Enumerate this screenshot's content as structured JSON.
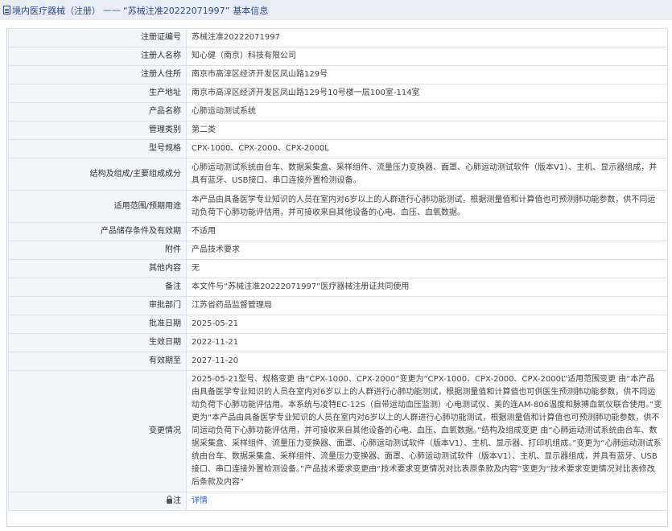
{
  "header": {
    "prefix": "境内医疗器械（注册）",
    "separator": "——",
    "reg_quoted": "“苏械注准20222071997”",
    "suffix": "基本信息"
  },
  "rows": [
    {
      "label": "注册证编号",
      "value": "苏械注准20222071997"
    },
    {
      "label": "注册人名称",
      "value": "知心健（南京）科技有限公司"
    },
    {
      "label": "注册人住所",
      "value": "南京市高淳区经济开发区凤山路129号"
    },
    {
      "label": "生产地址",
      "value": "南京市高淳区经济开发区凤山路129号10号楼一层100室-114室"
    },
    {
      "label": "产品名称",
      "value": "心肺运动测试系统"
    },
    {
      "label": "管理类别",
      "value": "第二类"
    },
    {
      "label": "型号规格",
      "value": "CPX-1000、CPX-2000、CPX-2000L"
    },
    {
      "label": "结构及组成/主要组成成分",
      "value": "心肺运动测试系统由台车、数据采集盒、采样组件、流量压力变换器、面罩、心肺运动测试软件（版本V1）、主机、显示器组成，并具有蓝牙、USB接口、串口连接外置检测设备。"
    },
    {
      "label": "适用范围/预期用途",
      "value": "本产品由具备医学专业知识的人员在室内对6岁以上的人群进行心肺功能测试，根据测量值和计算值也可预测肺功能参数，供不同运动负荷下心肺功能评估用，并可接收来自其他设备的心电、血压、血氧数据。"
    },
    {
      "label": "产品储存条件及有效期",
      "value": "不适用"
    },
    {
      "label": "附件",
      "value": "产品技术要求"
    },
    {
      "label": "其他内容",
      "value": "无"
    },
    {
      "label": "备注",
      "value": "本文件与“苏械注准20222071997”医疗器械注册证共同使用"
    },
    {
      "label": "审批部门",
      "value": "江苏省药品监督管理局"
    },
    {
      "label": "批准日期",
      "value": "2025-05-21"
    },
    {
      "label": "生效日期",
      "value": "2022-11-21"
    },
    {
      "label": "有效期至",
      "value": "2027-11-20"
    },
    {
      "label": "变更情况",
      "value": "2025-05-21型号、规格变更 由“CPX-1000、CPX-2000”变更为“CPX-1000、CPX-2000、CPX-2000L”适用范围变更 由“本产品由具备医学专业知识的人员在室内对6岁以上的人群进行心肺功能测试，根据测量值和计算值也可供医生预测肺功能参数，供不同运动负荷下心肺功能评估用。本系统与凌特EC-12S（自带运动血压监测）心电测试仪、美的连AM-806温度和脉搏血氧仪联合使用。”变更为“本产品由具备医学专业知识的人员在室内对6岁以上的人群进行心肺功能测试，根据测量值和计算值也可预测肺功能参数，供不同运动负荷下心肺功能评估用，并可接收来自其他设备的心电、血压、血氧数据。”结构及组成变更 由“心肺运动测试系统由台车、数据采集盒、采样组件、流量压力变换器、面罩、心肺运动测试软件（版本V1）、主机、显示器、打印机组成。”变更为“心肺运动测试系统由台车、数据采集盒、采样组件、流量压力变换器、面罩、心肺运动测试软件（版本V1）、主机、显示器组成，并具有蓝牙、USB接口、串口连接外置检测设备。”产品技术要求变更由“技术要求变更情况对比表原条款及内容”变更为“技术要求变更情况对比表修改后条款及内容”"
    }
  ],
  "detail_row": {
    "label": "注",
    "link": "详情"
  }
}
